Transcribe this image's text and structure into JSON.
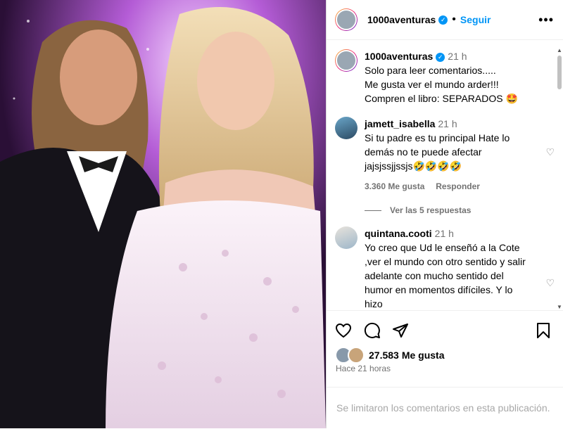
{
  "post": {
    "username": "1000aventuras",
    "follow_label": "Seguir",
    "separator": "•",
    "more_label": "•••"
  },
  "caption": {
    "username": "1000aventuras",
    "time": "21 h",
    "line1": "Solo para leer comentarios.....",
    "line2": "Me gusta ver el mundo arder!!!",
    "line3": "Compren el libro: SEPARADOS 🤩"
  },
  "comments": [
    {
      "username": "jamett_isabella",
      "time": "21 h",
      "text": "Si tu padre es tu principal Hate lo demás no te puede afectar jajsjssjjssjs🤣🤣🤣🤣",
      "likes": "3.360 Me gusta",
      "reply_label": "Responder",
      "view_replies": "Ver las 5 respuestas"
    },
    {
      "username": "quintana.cooti",
      "time": "21 h",
      "text": "Yo creo que Ud le enseñó a la Cote ,ver el mundo con otro sentido y salir adelante con mucho sentido del humor en momentos difíciles. Y lo hizo"
    }
  ],
  "actions": {
    "likes_count": "27.583",
    "likes_label": "Me gusta",
    "time_ago": "Hace 21 horas"
  },
  "footer": {
    "limited_text": "Se limitaron los comentarios en esta publicación."
  },
  "colors": {
    "accent": "#0095f6",
    "muted": "#737373"
  }
}
